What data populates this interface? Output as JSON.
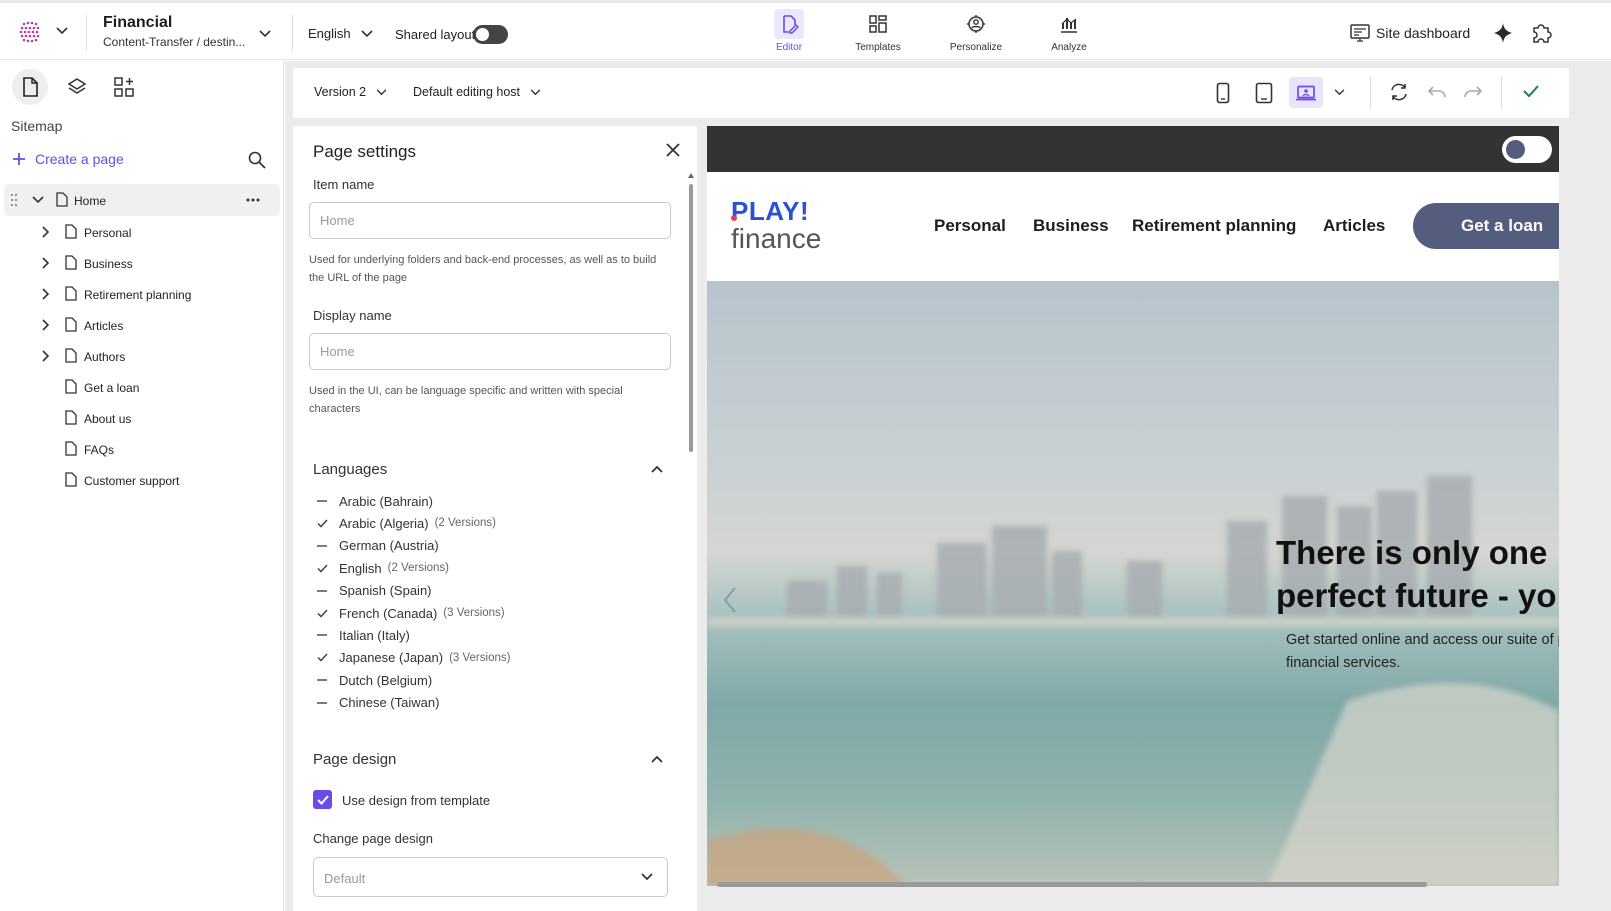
{
  "topbar": {
    "site_name": "Financial",
    "site_path": "Content-Transfer / destin...",
    "language": "English",
    "shared_layout_label": "Shared layout",
    "shared_layout_on": false,
    "tabs": [
      {
        "label": "Editor",
        "icon": "editor-icon",
        "active": true
      },
      {
        "label": "Templates",
        "icon": "templates-icon",
        "active": false
      },
      {
        "label": "Personalize",
        "icon": "personalize-icon",
        "active": false
      },
      {
        "label": "Analyze",
        "icon": "analyze-icon",
        "active": false
      }
    ],
    "site_dashboard_label": "Site dashboard",
    "accent_color": "#6b4be8"
  },
  "sidebar": {
    "section_title": "Sitemap",
    "create_page_label": "Create a page",
    "tree": {
      "root": "Home",
      "items": [
        "Personal",
        "Business",
        "Retirement planning",
        "Articles",
        "Authors",
        "Get a loan",
        "About us",
        "FAQs",
        "Customer support"
      ]
    }
  },
  "editor_toolbar": {
    "version_label": "Version 2",
    "host_label": "Default editing host"
  },
  "page_settings": {
    "title": "Page settings",
    "item_name_label": "Item name",
    "item_name_placeholder": "Home",
    "item_name_help": "Used for underlying folders and back-end processes, as well as to build the URL of the page",
    "display_name_label": "Display name",
    "display_name_placeholder": "Home",
    "display_name_help": "Used in the UI, can be language specific and written with special characters",
    "languages_title": "Languages",
    "languages": [
      {
        "name": "Arabic (Bahrain)",
        "has": false,
        "versions": ""
      },
      {
        "name": "Arabic (Algeria)",
        "has": true,
        "versions": "(2 Versions)"
      },
      {
        "name": "German (Austria)",
        "has": false,
        "versions": ""
      },
      {
        "name": "English",
        "has": true,
        "versions": "(2 Versions)"
      },
      {
        "name": "Spanish (Spain)",
        "has": false,
        "versions": ""
      },
      {
        "name": "French (Canada)",
        "has": true,
        "versions": "(3 Versions)"
      },
      {
        "name": "Italian (Italy)",
        "has": false,
        "versions": ""
      },
      {
        "name": "Japanese (Japan)",
        "has": true,
        "versions": "(3 Versions)"
      },
      {
        "name": "Dutch (Belgium)",
        "has": false,
        "versions": ""
      },
      {
        "name": "Chinese (Taiwan)",
        "has": false,
        "versions": ""
      }
    ],
    "page_design_title": "Page design",
    "use_design_label": "Use design from template",
    "use_design_checked": true,
    "change_design_label": "Change page design",
    "change_design_value": "Default"
  },
  "preview": {
    "logo_top": "PLAY!",
    "logo_bottom": "finance",
    "nav": [
      "Personal",
      "Business",
      "Retirement planning",
      "Articles"
    ],
    "cta": "Get a loan",
    "hero_title_line1": "There is only one",
    "hero_title_line2": "perfect future - yo",
    "hero_sub_line1": "Get started online and access our suite of p",
    "hero_sub_line2": "financial services.",
    "brand_color": "#2b4fd8",
    "cta_color": "#545d7e"
  }
}
